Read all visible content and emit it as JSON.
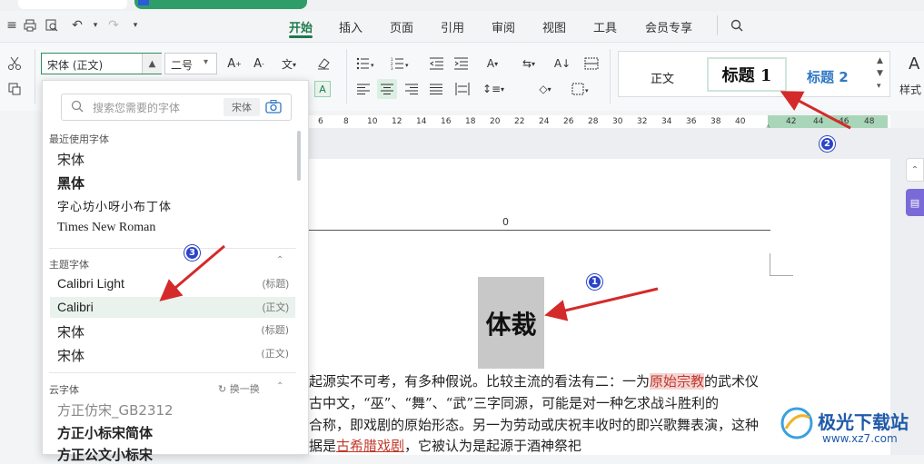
{
  "menu": {
    "items": [
      "开始",
      "插入",
      "页面",
      "引用",
      "审阅",
      "视图",
      "工具",
      "会员专享"
    ],
    "active": "开始"
  },
  "ribbon": {
    "font_name": "宋体 (正文)",
    "font_size": "二号",
    "styles": {
      "normal": "正文",
      "heading1": "标题  1",
      "heading2": "标题  2",
      "style_set_label": "样式"
    }
  },
  "ruler": {
    "left_ticks": [
      "6",
      "8",
      "10",
      "12",
      "14",
      "16",
      "18",
      "20",
      "22",
      "24",
      "26",
      "28",
      "30",
      "32",
      "34",
      "36",
      "38",
      "40"
    ],
    "right_ticks": [
      "42",
      "44",
      "46",
      "48"
    ]
  },
  "font_dropdown": {
    "search_placeholder": "搜索您需要的字体",
    "search_tag": "宋体",
    "recent_title": "最近使用字体",
    "recent": [
      "宋体",
      "黑体",
      "字心坊小呀小布丁体",
      "Times New Roman"
    ],
    "theme_title": "主题字体",
    "theme": [
      {
        "name": "Calibri Light",
        "tag": "(标题)"
      },
      {
        "name": "Calibri",
        "tag": "(正文)"
      },
      {
        "name": "宋体",
        "tag": "(标题)"
      },
      {
        "name": "宋体",
        "tag": "(正文)"
      }
    ],
    "cloud_title": "云字体",
    "cloud_refresh": "换一换",
    "cloud": [
      "方正仿宋_GB2312",
      "方正小标宋简体",
      "方正公文小标宋"
    ]
  },
  "document": {
    "header_number": "0",
    "title": "体裁",
    "lines": [
      {
        "pre": "起源实不可考，有多种假说。比较主流的看法有二：一为",
        "hl": "原始宗教",
        "post": "的武术仪"
      },
      {
        "pre": "古中文，“巫”、“舞”、“武”三字同源，可能是对一种乞求战斗胜利的"
      },
      {
        "pre": "合称，即戏剧的原始形态。另一为劳动或庆祝丰收时的即兴歌舞表演，这种"
      },
      {
        "pre": "据是",
        "ul": "古希腊戏剧",
        "post": "，它被认为是起源于酒神祭祀"
      }
    ]
  },
  "annotations": [
    "1",
    "2",
    "3"
  ],
  "watermark": {
    "title": "极光下载站",
    "url": "www.xz7.com"
  },
  "colors": {
    "accent": "#1e7a4c",
    "badge": "#2a43c8",
    "arrow": "#d42a2a",
    "heading2": "#2f78c4"
  }
}
